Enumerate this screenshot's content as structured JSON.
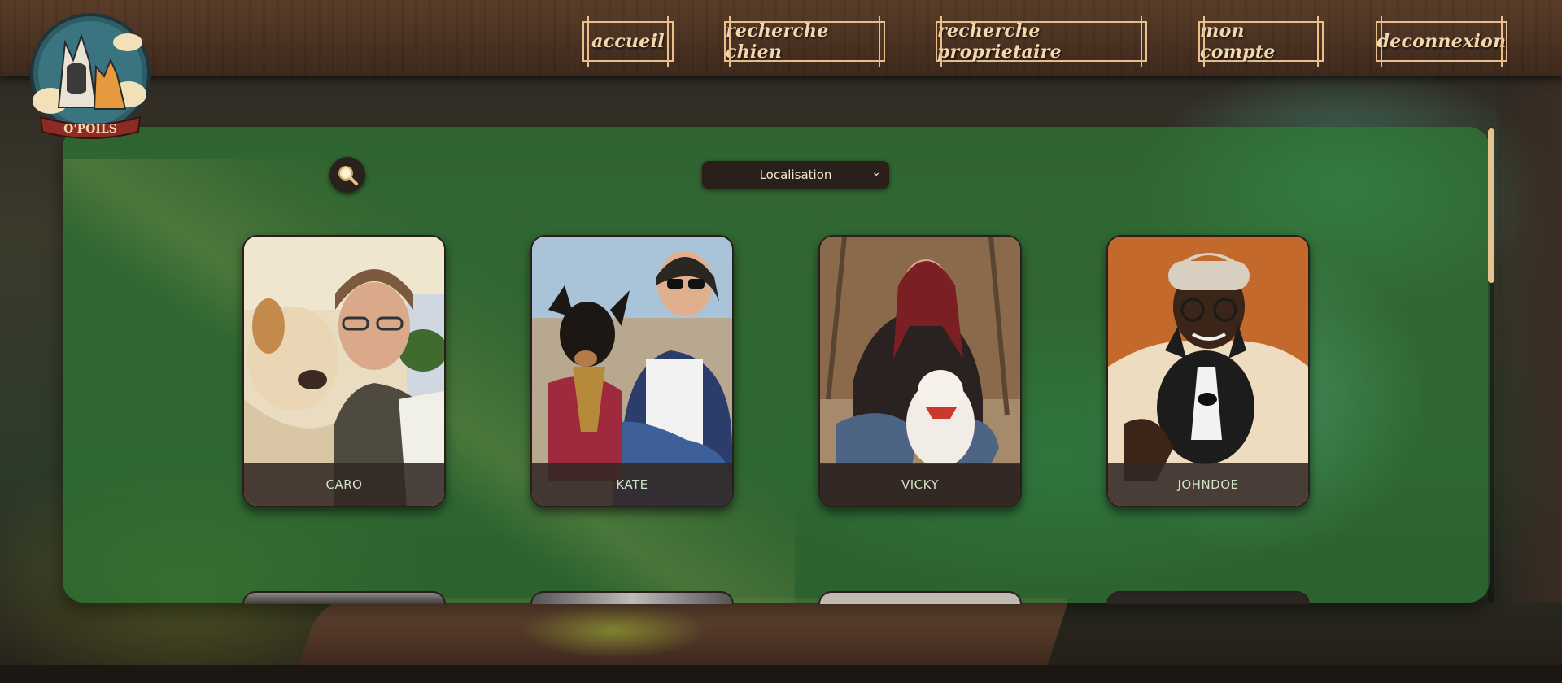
{
  "header": {
    "logo_text": "O'POILS",
    "nav": [
      {
        "label": "accueil"
      },
      {
        "label": "recherche chien"
      },
      {
        "label": "recherche proprietaire"
      },
      {
        "label": "mon compte"
      },
      {
        "label": "deconnexion"
      }
    ]
  },
  "search": {
    "icon": "magnifier-icon",
    "select_value": "Localisation"
  },
  "cards": [
    {
      "name": "CARO"
    },
    {
      "name": "KATE"
    },
    {
      "name": "VICKY"
    },
    {
      "name": "JOHNDOE"
    }
  ],
  "colors": {
    "header_wood": "#4b3222",
    "nav_border": "#e9c08c",
    "panel_green": "#2e7834",
    "scrollbar_thumb": "#e6c48f",
    "card_label_bg": "#322823"
  }
}
